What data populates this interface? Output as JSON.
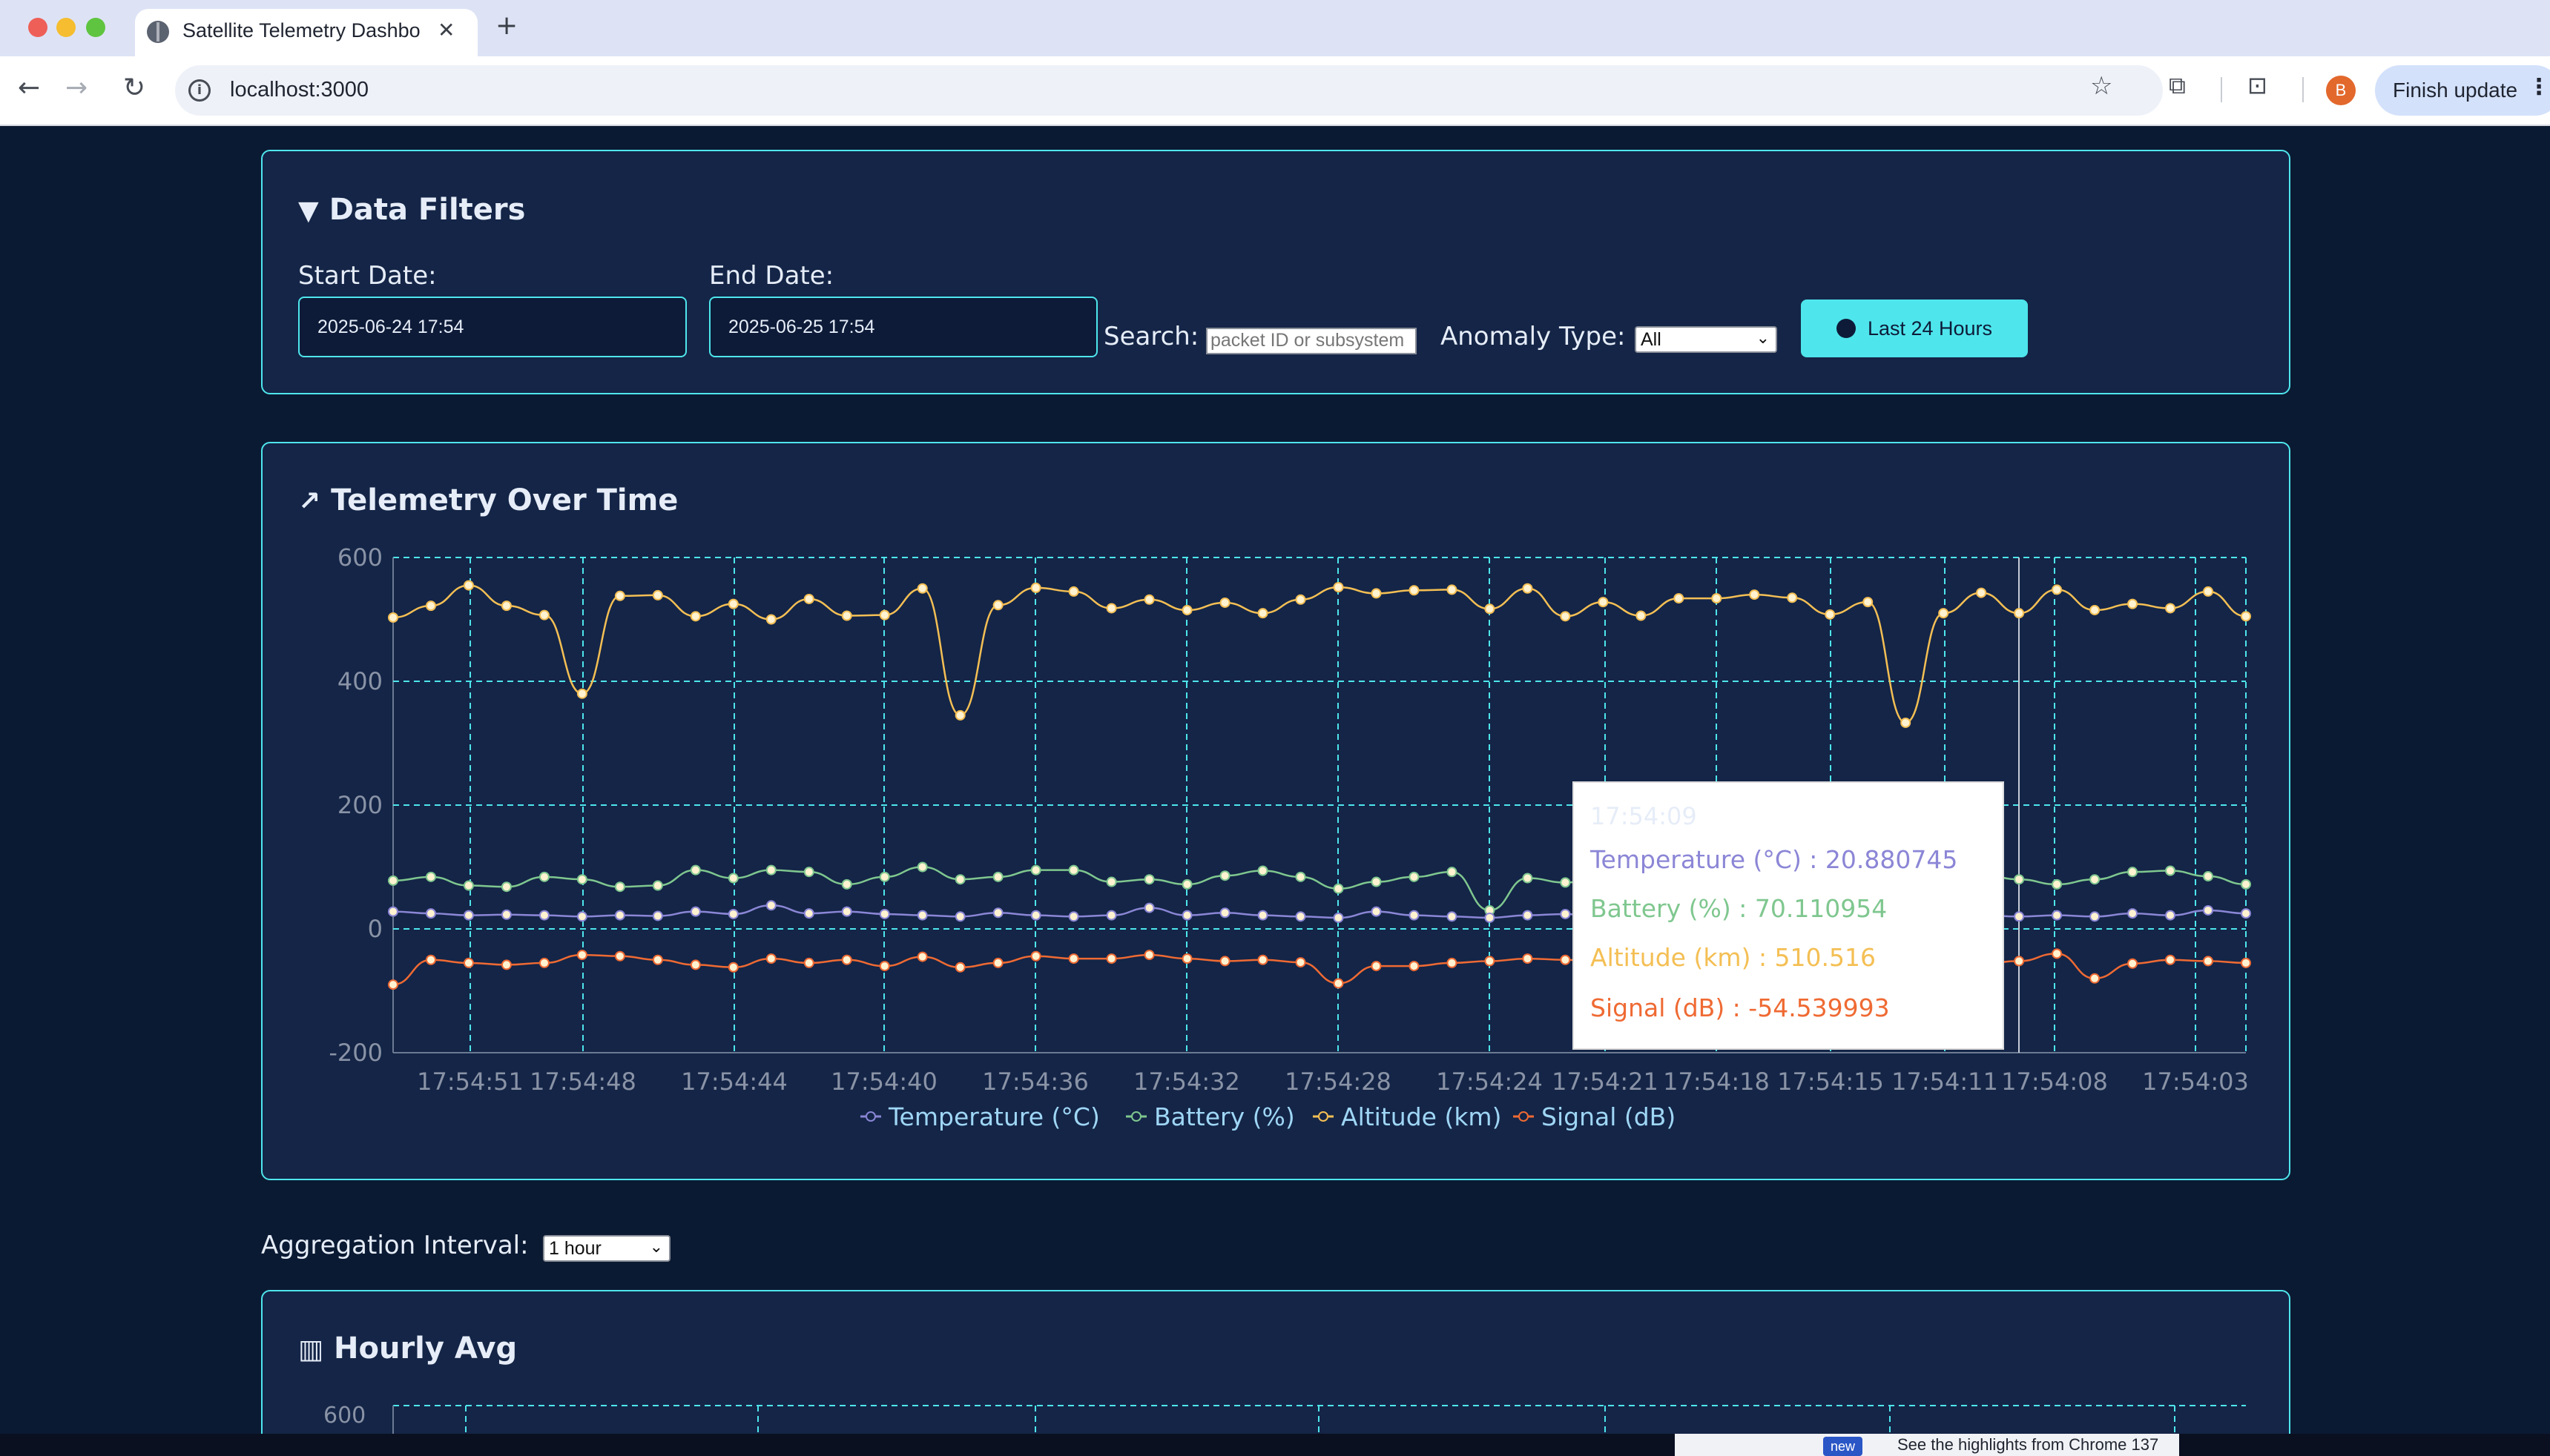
{
  "browser": {
    "tab_title": "Satellite Telemetry Dashboard",
    "url": "localhost:3000",
    "profile_initial": "B",
    "update_label": "Finish update"
  },
  "filters": {
    "title": "Data Filters",
    "start_label": "Start Date:",
    "start_value": "2025-06-24 17:54",
    "end_label": "End Date:",
    "end_value": "2025-06-25 17:54",
    "search_label": "Search:",
    "search_placeholder": "packet ID or subsystem",
    "anomaly_label": "Anomaly Type:",
    "anomaly_value": "All",
    "last24_label": "Last 24 Hours"
  },
  "telemetry": {
    "title": "Telemetry Over Time"
  },
  "tooltip": {
    "time": "17:54:09",
    "temperature": "Temperature (°C) : 20.880745",
    "battery": "Battery (%) : 70.110954",
    "altitude": "Altitude (km) : 510.516",
    "signal": "Signal (dB) : -54.539993"
  },
  "aggregation": {
    "label": "Aggregation Interval:",
    "value": "1 hour"
  },
  "hourly": {
    "title": "Hourly Avg",
    "first_tick": "600"
  },
  "promo": {
    "badge": "new",
    "text": "See the highlights from Chrome 137"
  },
  "colors": {
    "accent": "#4ee6ec",
    "panel": "#142547",
    "temperature": "#8b86d6",
    "battery": "#7fc78f",
    "altitude": "#f4bf54",
    "signal": "#ef6a33"
  },
  "chart_data": {
    "type": "line",
    "x": [
      "17:54:51",
      "17:54:48",
      "17:54:44",
      "17:54:40",
      "17:54:36",
      "17:54:32",
      "17:54:28",
      "17:54:24",
      "17:54:21",
      "17:54:18",
      "17:54:15",
      "17:54:11",
      "17:54:08",
      "17:54:03"
    ],
    "ylim": [
      -200,
      600
    ],
    "yticks": [
      "600",
      "400",
      "200",
      "0",
      "-200"
    ],
    "legend": [
      "Temperature (°C)",
      "Battery (%)",
      "Altitude (km)",
      "Signal (dB)"
    ],
    "legend_position": "bottom",
    "grid": true,
    "series": [
      {
        "name": "Altitude (km)",
        "values": [
          503,
          522,
          555,
          522,
          507,
          380,
          538,
          539,
          505,
          525,
          500,
          533,
          506,
          507,
          550,
          345,
          523,
          551,
          545,
          518,
          532,
          515,
          527,
          510,
          532,
          552,
          542,
          547,
          548,
          517,
          550,
          505,
          528,
          506,
          534,
          534,
          540,
          535,
          508,
          528,
          333,
          510,
          543,
          510,
          548,
          515,
          525,
          518,
          545,
          505
        ]
      },
      {
        "name": "Battery (%)",
        "values": [
          78,
          84,
          70,
          68,
          84,
          80,
          68,
          70,
          95,
          82,
          95,
          92,
          72,
          84,
          100,
          80,
          84,
          95,
          95,
          76,
          80,
          72,
          86,
          94,
          84,
          65,
          76,
          84,
          92,
          30,
          82,
          75,
          80,
          85,
          90,
          92,
          88,
          80,
          85,
          90,
          92,
          95,
          88,
          80,
          72,
          80,
          92,
          94,
          85,
          72
        ]
      },
      {
        "name": "Temperature (°C)",
        "values": [
          28,
          25,
          22,
          23,
          22,
          20,
          22,
          21,
          28,
          24,
          38,
          25,
          28,
          24,
          22,
          20,
          26,
          22,
          20,
          22,
          34,
          22,
          26,
          22,
          20,
          18,
          28,
          22,
          20,
          18,
          22,
          24,
          20,
          22,
          24,
          25,
          22,
          20,
          24,
          22,
          20,
          22,
          22,
          20,
          22,
          20,
          25,
          22,
          30,
          25
        ]
      },
      {
        "name": "Signal (dB)",
        "values": [
          -90,
          -50,
          -55,
          -58,
          -55,
          -42,
          -44,
          -50,
          -58,
          -62,
          -48,
          -55,
          -50,
          -60,
          -45,
          -62,
          -55,
          -44,
          -48,
          -48,
          -42,
          -48,
          -52,
          -50,
          -54,
          -88,
          -60,
          -60,
          -55,
          -52,
          -48,
          -50,
          -52,
          -58,
          -45,
          -52,
          -50,
          -56,
          -48,
          -50,
          -52,
          -55,
          -56,
          -52,
          -40,
          -80,
          -56,
          -50,
          -52,
          -55
        ]
      }
    ]
  }
}
